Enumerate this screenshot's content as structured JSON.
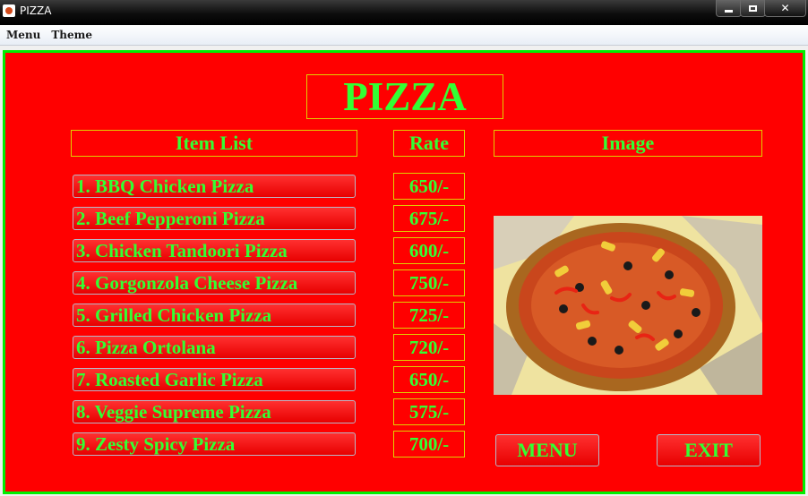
{
  "window": {
    "title": "PIZZA",
    "close_glyph": "✕"
  },
  "menubar": {
    "items": [
      "Menu",
      "Theme"
    ]
  },
  "main": {
    "title": "PIZZA",
    "columns": {
      "items": "Item List",
      "rate": "Rate",
      "image": "Image"
    },
    "items": [
      {
        "label": "1. BBQ Chicken Pizza",
        "rate": "650/-"
      },
      {
        "label": "2. Beef Pepperoni Pizza",
        "rate": "675/-"
      },
      {
        "label": "3. Chicken Tandoori Pizza",
        "rate": "600/-"
      },
      {
        "label": "4. Gorgonzola Cheese Pizza",
        "rate": "750/-"
      },
      {
        "label": "5. Grilled Chicken Pizza",
        "rate": "725/-"
      },
      {
        "label": "6. Pizza Ortolana",
        "rate": "720/-"
      },
      {
        "label": "7. Roasted Garlic Pizza",
        "rate": "650/-"
      },
      {
        "label": "8. Veggie Supreme Pizza",
        "rate": "575/-"
      },
      {
        "label": "9. Zesty Spicy Pizza",
        "rate": "700/-"
      }
    ],
    "buttons": {
      "menu": "MENU",
      "exit": "EXIT"
    }
  },
  "colors": {
    "panel_background": "#ff0000",
    "panel_border": "#00ee00",
    "text": "#33ff33",
    "heading_border": "#e0d000"
  },
  "icons": {
    "app": "java-cup-icon",
    "minimize": "minimize-icon",
    "maximize": "maximize-icon",
    "close": "close-icon"
  }
}
